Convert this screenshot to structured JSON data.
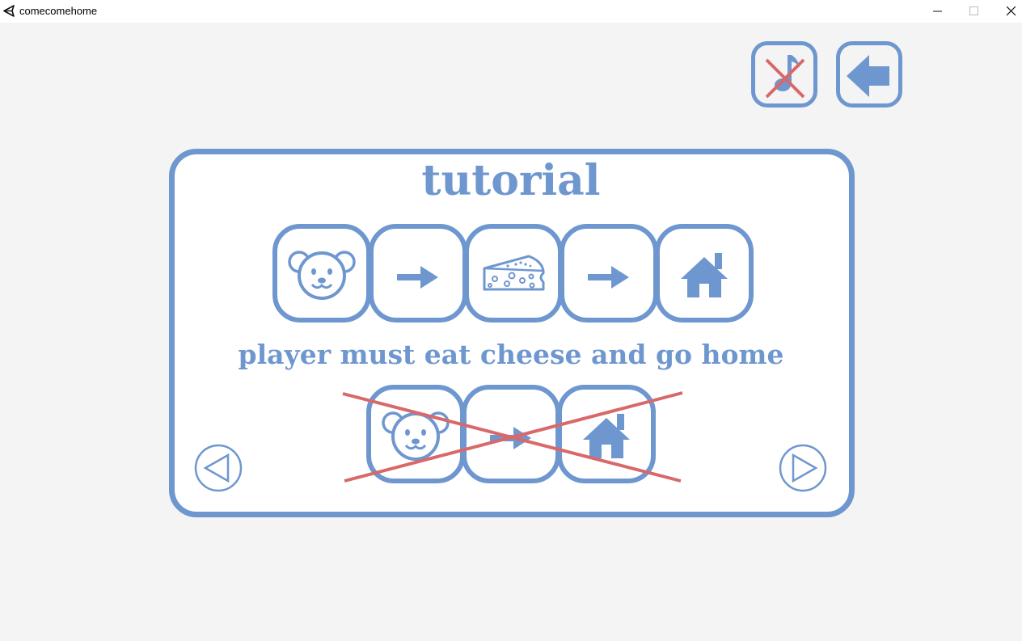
{
  "window": {
    "title": "comecomehome",
    "controls": [
      "minimize",
      "maximize",
      "close"
    ]
  },
  "toolbar": {
    "music_button_icon": "music-note-muted-icon",
    "back_button_icon": "back-arrow-icon"
  },
  "tutorial": {
    "title": "tutorial",
    "correct_sequence": [
      "mouse-icon",
      "arrow-right-icon",
      "cheese-icon",
      "arrow-right-icon",
      "house-icon"
    ],
    "caption": "player must eat cheese and go home",
    "wrong_sequence": [
      "mouse-icon",
      "arrow-right-icon",
      "house-icon"
    ],
    "wrong_sequence_crossed": true
  },
  "navigation": {
    "prev_icon": "triangle-left-icon",
    "next_icon": "triangle-right-icon"
  },
  "colors": {
    "accent": "#6f97cf",
    "cross": "#d9686a",
    "background": "#f4f4f4",
    "panel": "#ffffff"
  }
}
